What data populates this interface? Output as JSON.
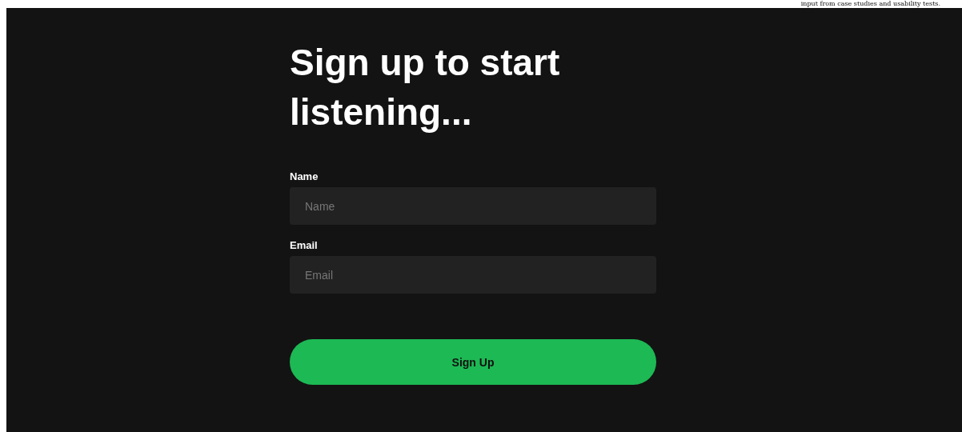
{
  "caption": "input from case studies and usability tests.",
  "heading": "Sign up to start listening...",
  "fields": [
    {
      "label": "Name",
      "placeholder": "Name"
    },
    {
      "label": "Email",
      "placeholder": "Email"
    }
  ],
  "submit": "Sign Up"
}
